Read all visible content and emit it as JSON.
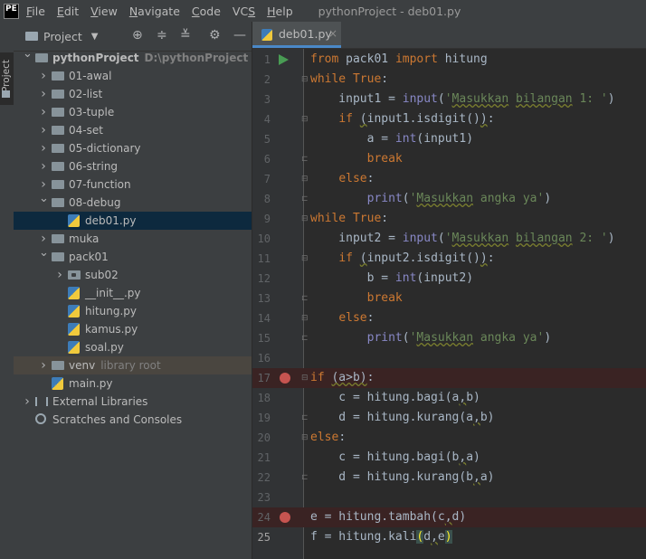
{
  "app": {
    "logo": "PE",
    "menu": [
      "File",
      "Edit",
      "View",
      "Navigate",
      "Code",
      "VCS",
      "Help"
    ],
    "menu_mnemonics": [
      "F",
      "E",
      "V",
      "N",
      "C",
      "S",
      "H"
    ],
    "window_title": "pythonProject - deb01.py"
  },
  "side_tab": {
    "label": "Project"
  },
  "project_panel": {
    "title": "Project",
    "toolbar_icons": [
      "crosshair-icon",
      "expand-all-icon",
      "collapse-all-icon",
      "gear-icon",
      "minimize-icon"
    ]
  },
  "tree": [
    {
      "label": "pythonProject",
      "hint": "D:\\pythonProject",
      "type": "folder",
      "depth": 0,
      "expanded": true,
      "bold": true
    },
    {
      "label": "01-awal",
      "type": "folder",
      "depth": 1,
      "expanded": false
    },
    {
      "label": "02-list",
      "type": "folder",
      "depth": 1,
      "expanded": false
    },
    {
      "label": "03-tuple",
      "type": "folder",
      "depth": 1,
      "expanded": false
    },
    {
      "label": "04-set",
      "type": "folder",
      "depth": 1,
      "expanded": false
    },
    {
      "label": "05-dictionary",
      "type": "folder",
      "depth": 1,
      "expanded": false
    },
    {
      "label": "06-string",
      "type": "folder",
      "depth": 1,
      "expanded": false
    },
    {
      "label": "07-function",
      "type": "folder",
      "depth": 1,
      "expanded": false
    },
    {
      "label": "08-debug",
      "type": "folder",
      "depth": 1,
      "expanded": true
    },
    {
      "label": "deb01.py",
      "type": "py",
      "depth": 2,
      "selected": true
    },
    {
      "label": "muka",
      "type": "folder",
      "depth": 1,
      "expanded": false
    },
    {
      "label": "pack01",
      "type": "folder",
      "depth": 1,
      "expanded": true
    },
    {
      "label": "sub02",
      "type": "package",
      "depth": 2,
      "expanded": false
    },
    {
      "label": "__init__.py",
      "type": "py",
      "depth": 2
    },
    {
      "label": "hitung.py",
      "type": "py",
      "depth": 2
    },
    {
      "label": "kamus.py",
      "type": "py",
      "depth": 2
    },
    {
      "label": "soal.py",
      "type": "py",
      "depth": 2
    },
    {
      "label": "venv",
      "hint": "library root",
      "type": "folder",
      "depth": 1,
      "expanded": false,
      "excluded": true
    },
    {
      "label": "main.py",
      "type": "py",
      "depth": 1
    },
    {
      "label": "External Libraries",
      "type": "libs",
      "depth": 0,
      "expanded": false
    },
    {
      "label": "Scratches and Consoles",
      "type": "scratch",
      "depth": 0
    }
  ],
  "editor": {
    "tab_label": "deb01.py",
    "tab_close": "×",
    "current_line": 25,
    "lines": [
      {
        "num": "1",
        "run": true,
        "code": "<span class=\"kw\">from</span> pack01 <span class=\"kw\">import</span> hitung"
      },
      {
        "num": "2",
        "fold": "open",
        "code": "<span class=\"kw\">while</span> <span class=\"kw\">True</span>:"
      },
      {
        "num": "3",
        "code": "    input1 = <span class=\"bi\">input</span>(<span class=\"str\">'<span class=\"wavy\">Masukkan</span> <span class=\"wavy\">bilangan</span> 1: '</span>)"
      },
      {
        "num": "4",
        "fold": "open",
        "code": "    <span class=\"kw\">if</span> <span class=\"wavy\">(</span>input1.isdigit()<span class=\"wavy\">)</span>:"
      },
      {
        "num": "5",
        "code": "        a = <span class=\"bi\">int</span>(input1)"
      },
      {
        "num": "6",
        "fold": "close",
        "code": "        <span class=\"kw\">break</span>"
      },
      {
        "num": "7",
        "fold": "open",
        "code": "    <span class=\"kw\">else</span>:"
      },
      {
        "num": "8",
        "fold": "close",
        "code": "        <span class=\"bi\">print</span>(<span class=\"str\">'<span class=\"wavy\">Masukkan</span> angka ya'</span>)"
      },
      {
        "num": "9",
        "fold": "open",
        "code": "<span class=\"kw\">while</span> <span class=\"kw\">True</span>:"
      },
      {
        "num": "10",
        "code": "    input2 = <span class=\"bi\">input</span>(<span class=\"str\">'<span class=\"wavy\">Masukkan</span> <span class=\"wavy\">bilangan</span> 2: '</span>)"
      },
      {
        "num": "11",
        "fold": "open",
        "code": "    <span class=\"kw\">if</span> <span class=\"wavy\">(</span>input2.isdigit()<span class=\"wavy\">)</span>:"
      },
      {
        "num": "12",
        "code": "        b = <span class=\"bi\">int</span>(input2)"
      },
      {
        "num": "13",
        "fold": "close",
        "code": "        <span class=\"kw\">break</span>"
      },
      {
        "num": "14",
        "fold": "open",
        "code": "    <span class=\"kw\">else</span>:"
      },
      {
        "num": "15",
        "fold": "close",
        "code": "        <span class=\"bi\">print</span>(<span class=\"str\">'<span class=\"wavy\">Masukkan</span> angka ya'</span>)"
      },
      {
        "num": "16",
        "code": ""
      },
      {
        "num": "17",
        "breakpoint": true,
        "fold": "open",
        "code": "<span class=\"kw\">if</span> <span class=\"wavy\">(a&gt;b)</span>:"
      },
      {
        "num": "18",
        "code": "    c = hitung.bagi(a<span class=\"wavy\">,</span>b)"
      },
      {
        "num": "19",
        "fold": "close",
        "code": "    d = hitung.kurang(a<span class=\"wavy\">,</span>b)"
      },
      {
        "num": "20",
        "fold": "open",
        "code": "<span class=\"kw\">else</span>:"
      },
      {
        "num": "21",
        "code": "    c = hitung.bagi(b<span class=\"wavy\">,</span>a)"
      },
      {
        "num": "22",
        "fold": "close",
        "code": "    d = hitung.kurang(b<span class=\"wavy\">,</span>a)"
      },
      {
        "num": "23",
        "code": ""
      },
      {
        "num": "24",
        "breakpoint": true,
        "code": "e = hitung.tambah(c<span class=\"wavy\">,</span>d)"
      },
      {
        "num": "25",
        "code": "f = hitung.kali<span class=\"hl\">(</span>d<span class=\"wavy\">,</span>e<span class=\"hl\">)</span>"
      }
    ]
  },
  "colors": {
    "keyword": "#cc7832",
    "builtin": "#8888c6",
    "string": "#6a8759",
    "breakpoint": "#c75450",
    "run": "#499c54",
    "selection": "#0d293e"
  }
}
